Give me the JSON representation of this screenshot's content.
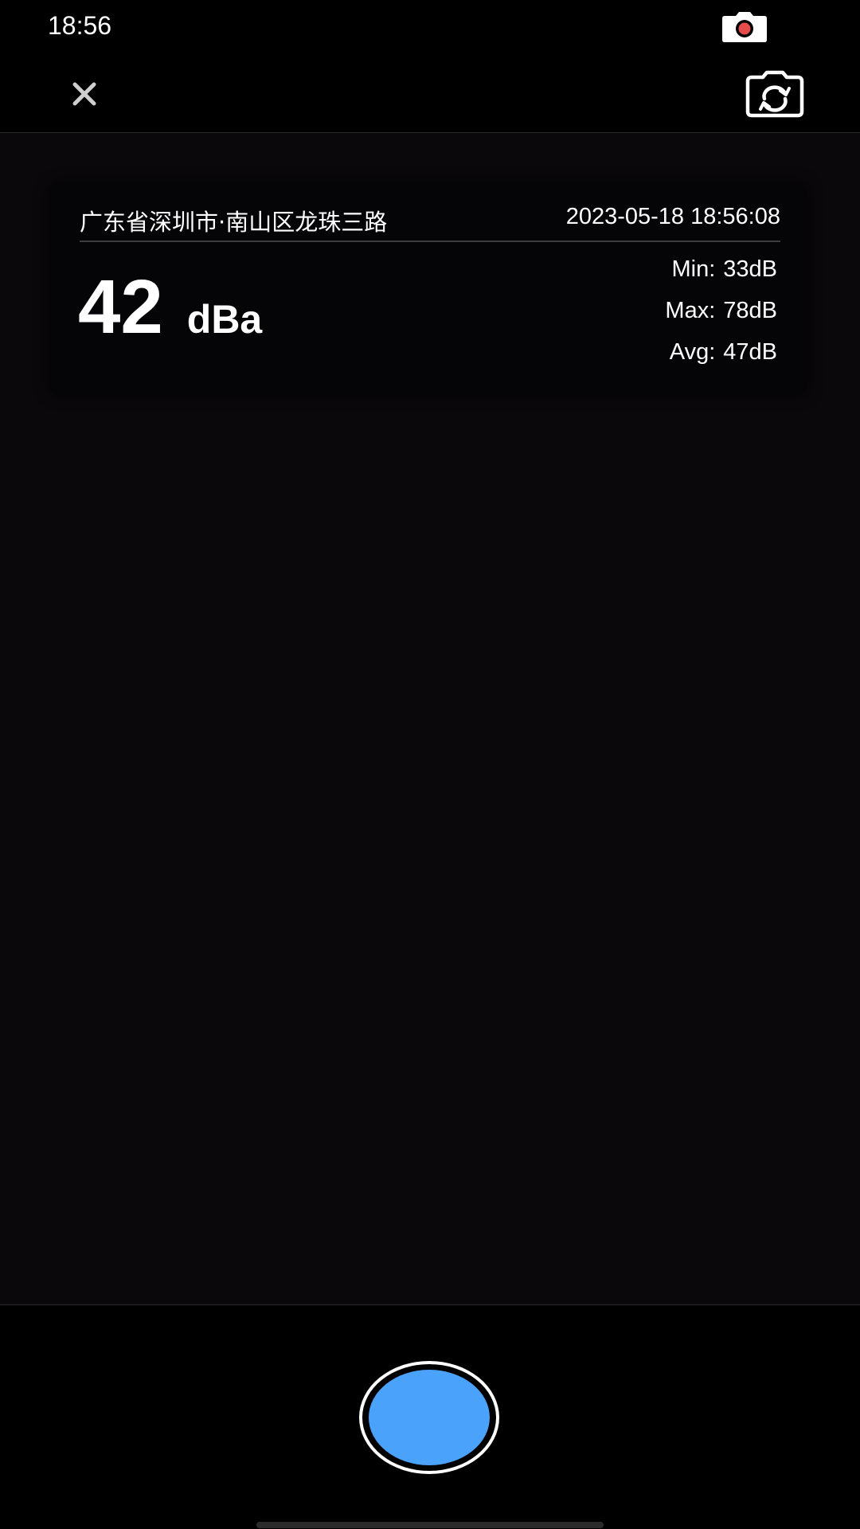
{
  "status_bar": {
    "time": "18:56",
    "recording_icon": "camera-recording-icon",
    "recording_color": "#e74c4c"
  },
  "top_bar": {
    "close_icon": "close-icon",
    "flip_icon": "camera-flip-icon"
  },
  "card": {
    "location": "广东省深圳市·南山区龙珠三路",
    "datetime": "2023-05-18 18:56:08",
    "reading_value": "42",
    "reading_unit": "dBa",
    "stats": [
      {
        "label": "Min:",
        "value": "33dB"
      },
      {
        "label": "Max:",
        "value": "78dB"
      },
      {
        "label": "Avg:",
        "value": "47dB"
      }
    ]
  },
  "controls": {
    "shutter_color": "#4ba2fa"
  }
}
